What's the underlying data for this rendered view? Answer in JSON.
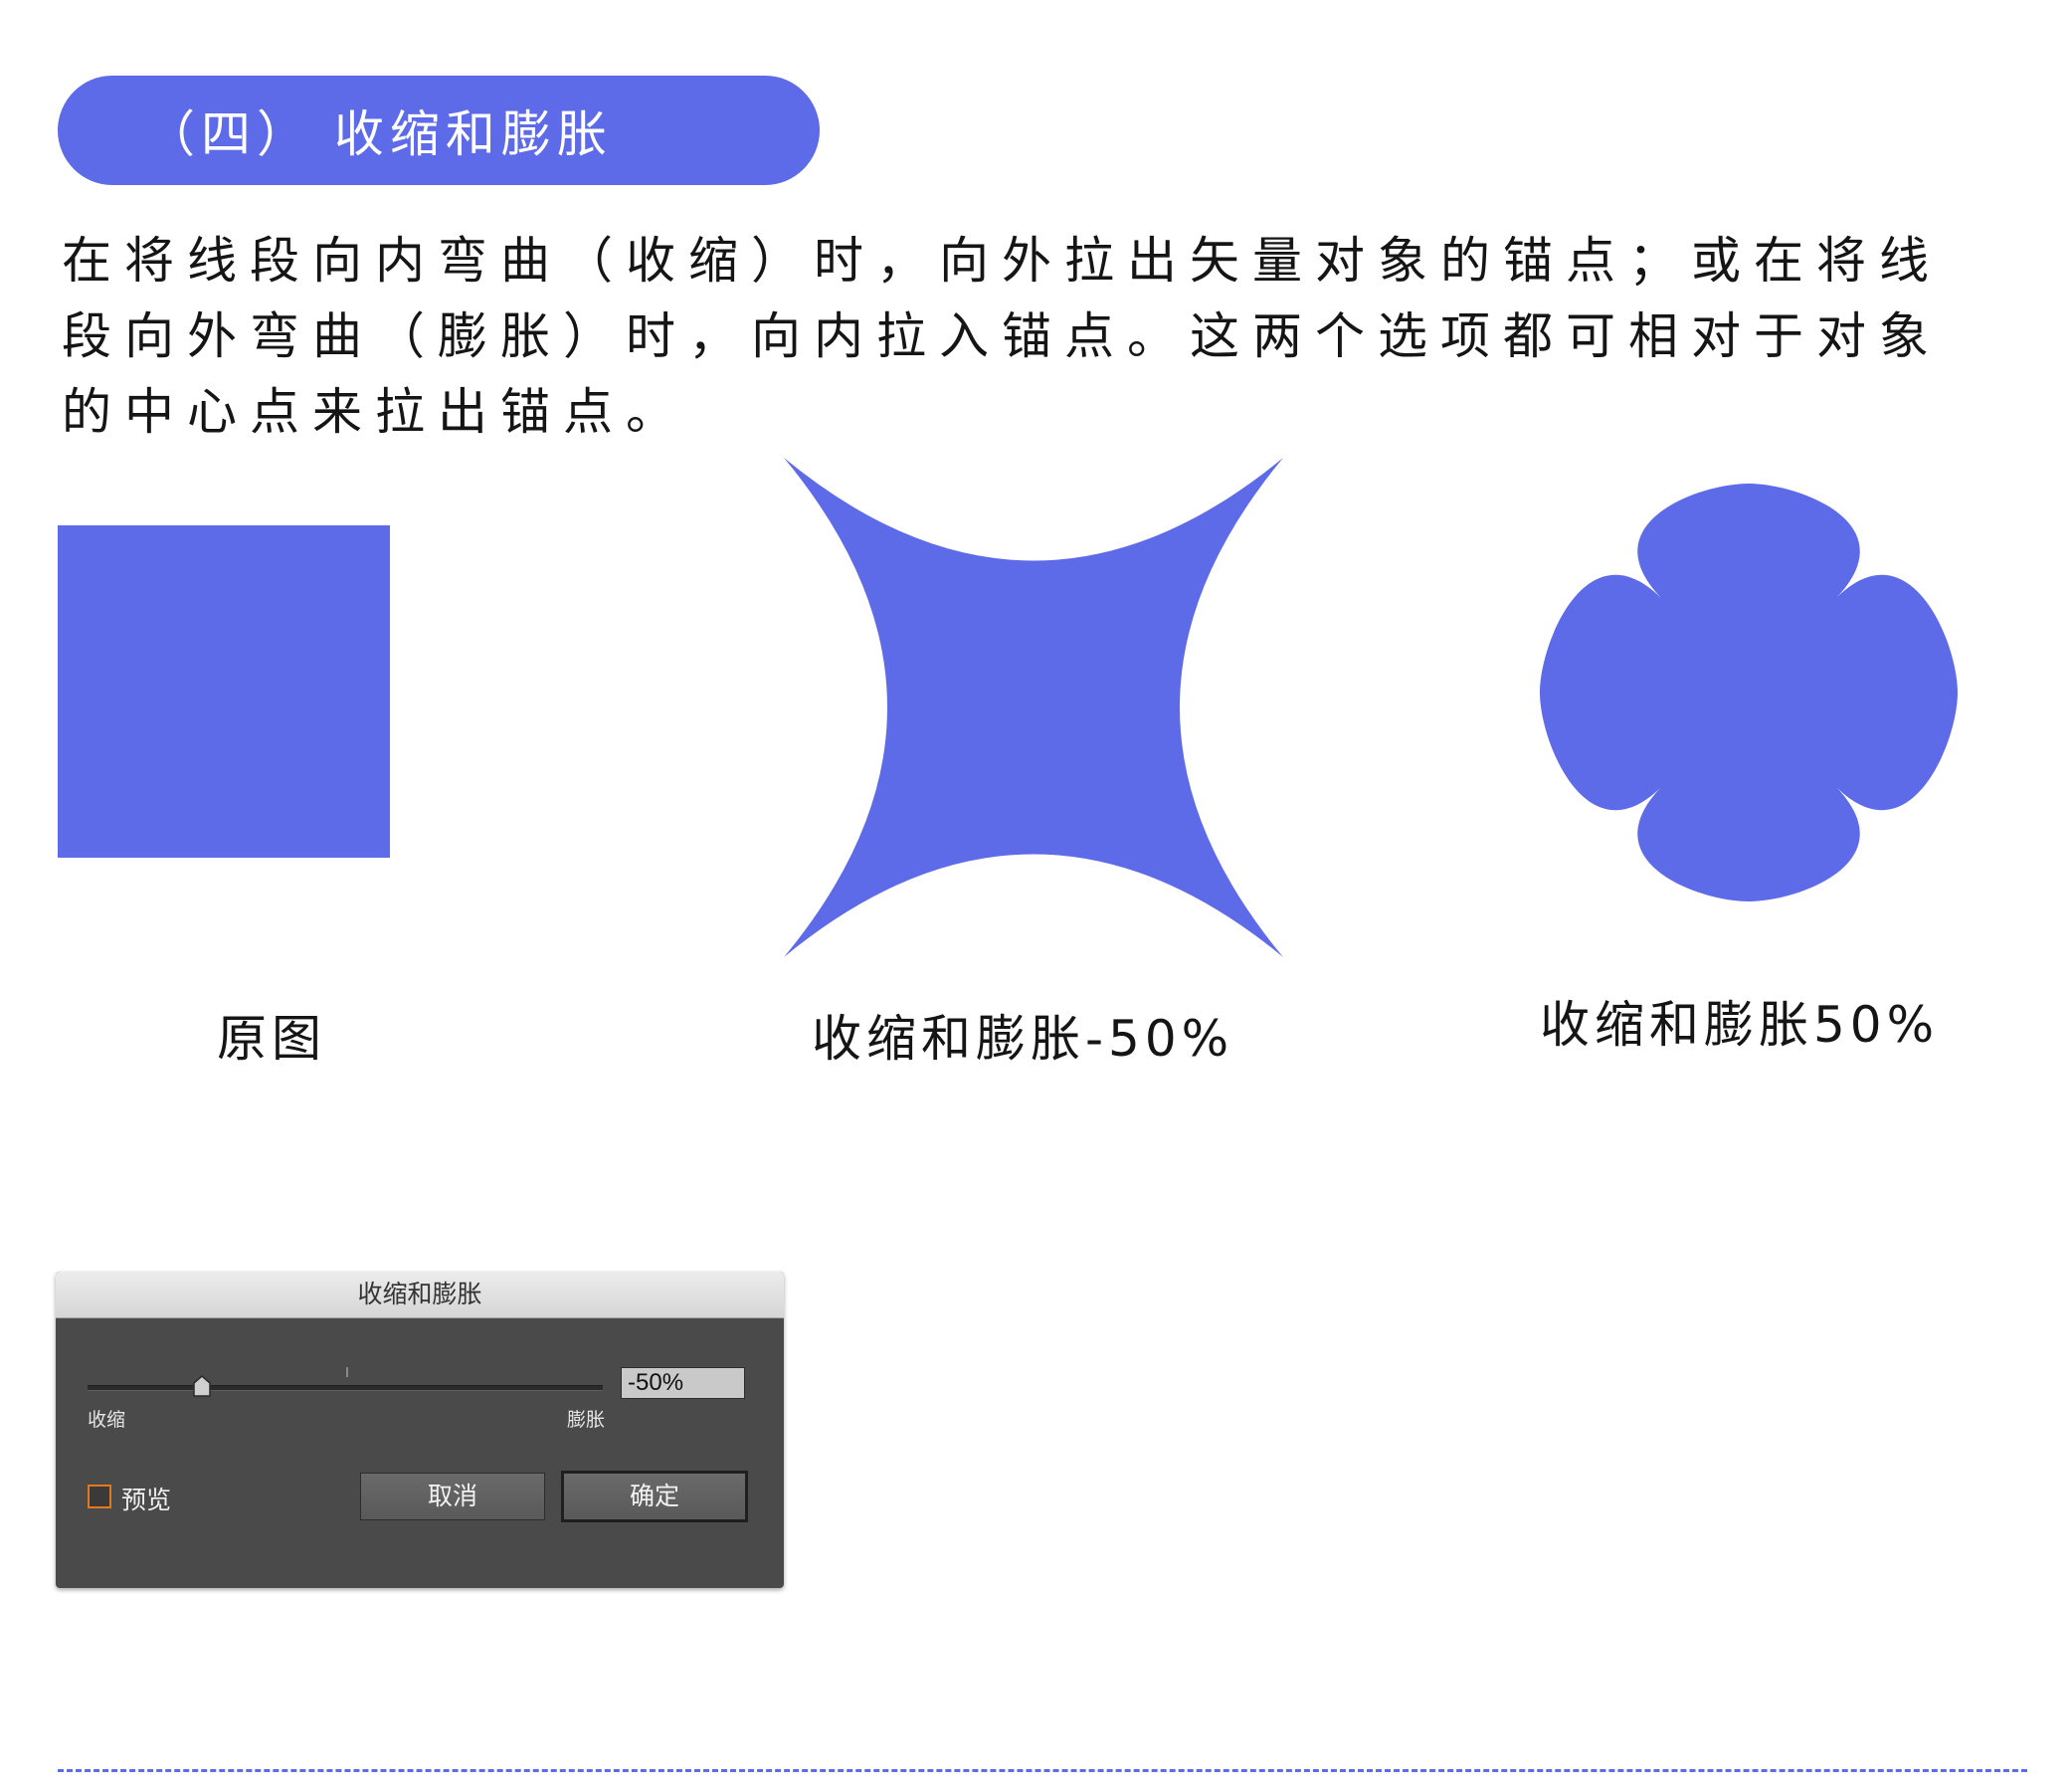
{
  "header": {
    "title": "（四） 收缩和膨胀"
  },
  "description": "在将线段向内弯曲（收缩）时，向外拉出矢量对象的锚点；或在将线段向外弯曲（膨胀）时，向内拉入锚点。这两个选项都可相对于对象的中心点来拉出锚点。",
  "examples": [
    {
      "caption": "原图"
    },
    {
      "caption": "收缩和膨胀-50%"
    },
    {
      "caption": "收缩和膨胀50%"
    }
  ],
  "dialog": {
    "title": "收缩和膨胀",
    "slider": {
      "value": -50,
      "min": -100,
      "max": 100
    },
    "value_text": "-50%",
    "left_label": "收缩",
    "right_label": "膨胀",
    "preview_label": "预览",
    "preview_checked": false,
    "cancel_label": "取消",
    "ok_label": "确定"
  },
  "colors": {
    "accent": "#5e6be8",
    "shape_fill": "#5e6be8",
    "checkbox_border": "#e07a1d"
  }
}
